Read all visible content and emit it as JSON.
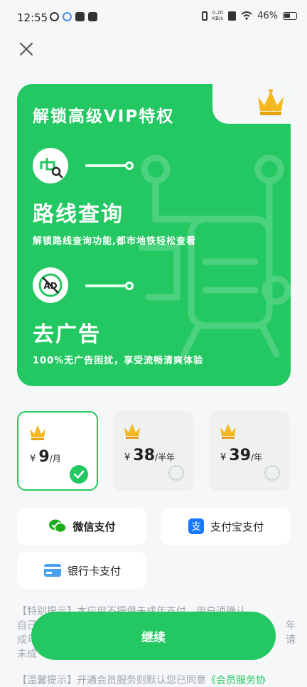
{
  "status_bar": {
    "time": "12:55",
    "net_speed_value": "0.20",
    "net_speed_unit": "KB/s",
    "battery": "46%"
  },
  "vip_card": {
    "title": "解锁高级VIP特权",
    "feature1": {
      "name": "路线查询",
      "desc": "解锁路线查询功能,都市地铁轻松查看"
    },
    "feature2": {
      "name": "去广告",
      "desc": "100%无广告困扰，享受流畅清爽体验"
    }
  },
  "plans": [
    {
      "currency": "¥",
      "amount": "9",
      "unit": "/月",
      "selected": true
    },
    {
      "currency": "¥",
      "amount": "38",
      "unit": "/半年",
      "selected": false
    },
    {
      "currency": "¥",
      "amount": "39",
      "unit": "/年",
      "selected": false
    }
  ],
  "payment": {
    "wechat": "微信支付",
    "alipay": "支付宝支付",
    "bank": "银行卡支付"
  },
  "notice": {
    "line1": "【特别提示】本应用不提倡未成年支付，用户须确认",
    "line2": "自己",
    "line2_tail": "年",
    "line3": "成年",
    "line3_tail": "请",
    "line4": "未成"
  },
  "continue_label": "继续",
  "agreement": {
    "prefix": "【温馨提示】开通会员服务则默认您已同意",
    "link": "《会员服务协"
  },
  "colors": {
    "accent": "#24c862"
  }
}
